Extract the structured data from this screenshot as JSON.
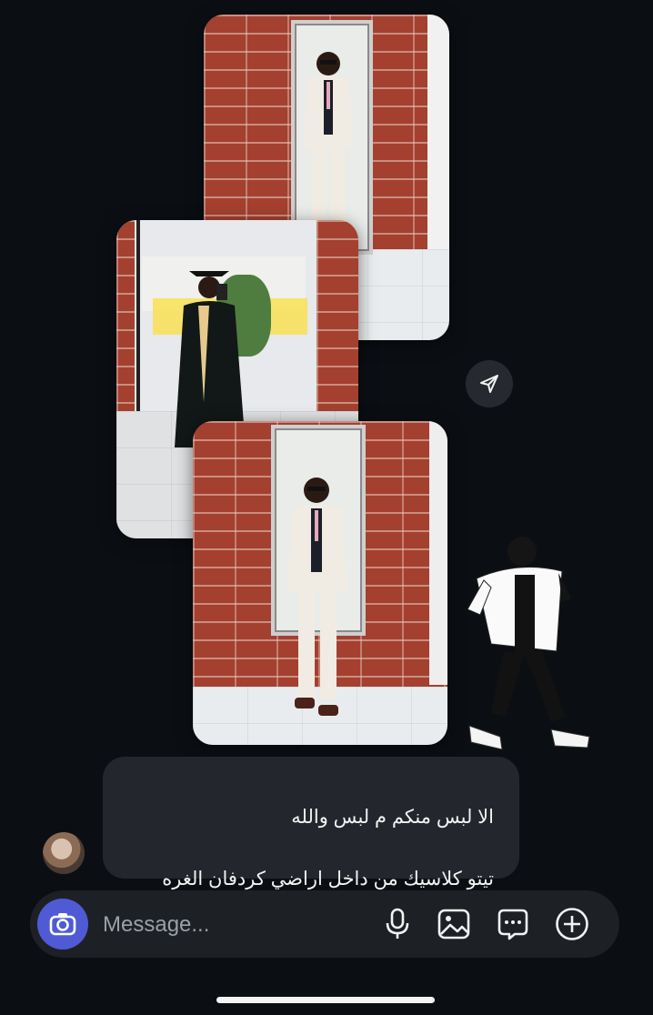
{
  "message": {
    "lines": [
      "الا لبس منكم م لبس والله",
      "تيتو كلاسيك من داخل اراضي كردفان الغره",
      "🔥🔥🔥"
    ]
  },
  "composer": {
    "placeholder": "Message...",
    "icons": [
      "camera-icon",
      "microphone-icon",
      "image-icon",
      "sticker-icon",
      "plus-icon"
    ]
  },
  "colors": {
    "background": "#0b0f14",
    "bubble": "#23272d",
    "camera_button": "#4f5bd5",
    "composer": "#1d2126"
  }
}
